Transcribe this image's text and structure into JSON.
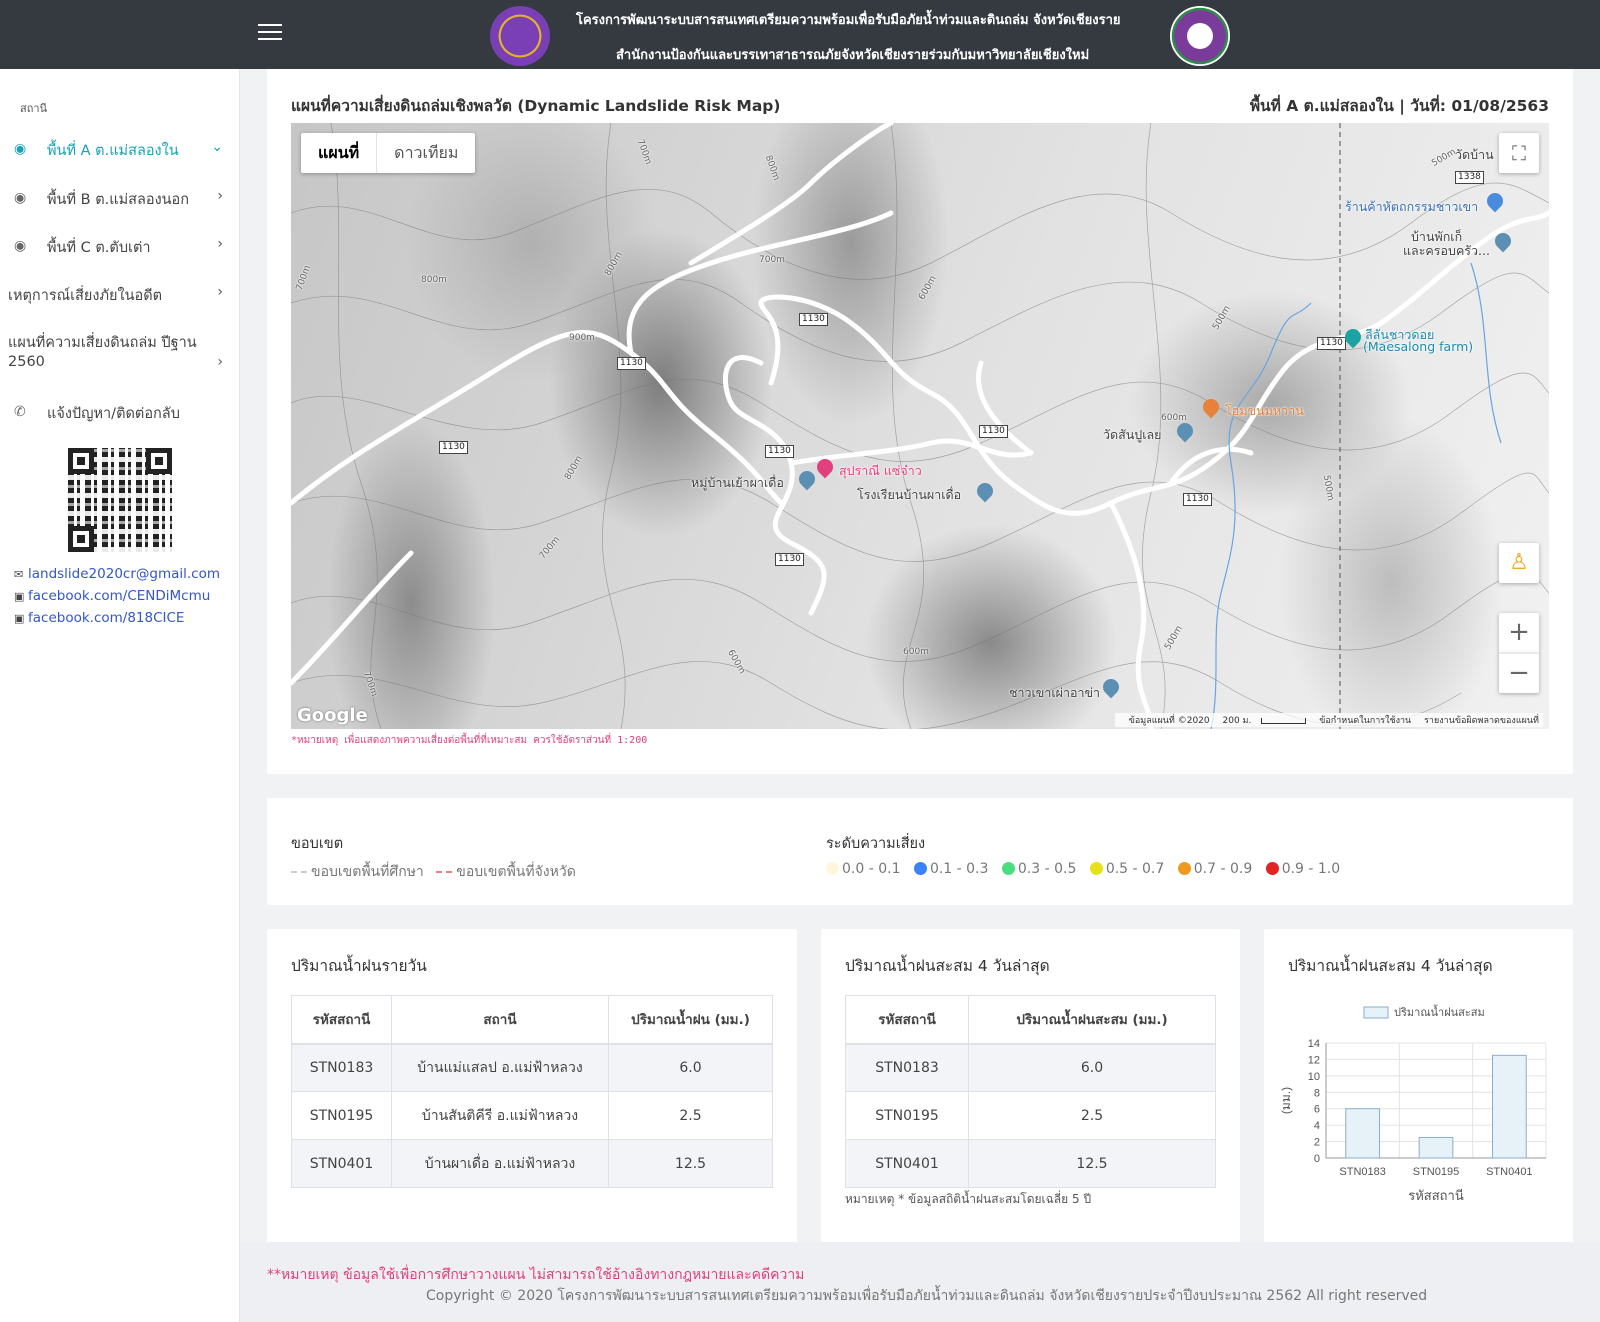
{
  "header": {
    "line1": "โครงการพัฒนาระบบสารสนเทศเตรียมความพร้อมเพื่อรับมือภัยน้ำท่วมและดินถล่ม จังหวัดเชียงราย",
    "line2": "สำนักงานป้องกันและบรรเทาสาธารณภัยจังหวัดเชียงรายร่วมกับมหาวิทยาลัยเชียงใหม่"
  },
  "sidebar": {
    "heading": "สถานี",
    "items": [
      {
        "label": "พื้นที่ A ต.แม่สลองใน",
        "icon": "map-pin-icon",
        "expanded": true
      },
      {
        "label": "พื้นที่ B ต.แม่สลองนอก",
        "icon": "map-pin-icon"
      },
      {
        "label": "พื้นที่ C ต.ตับเต่า",
        "icon": "map-pin-icon"
      },
      {
        "label": "เหตุการณ์เสี่ยงภัยในอดีต"
      },
      {
        "label_line1": "แผนที่ความเสี่ยงดินถล่ม ปีฐาน",
        "label_line2": "2560"
      },
      {
        "label": "แจ้งปัญหา/ติดต่อกลับ",
        "icon": "phone-icon"
      }
    ],
    "contacts": [
      {
        "text": "landslide2020cr@gmail.com",
        "icon": "envelope-icon"
      },
      {
        "text": "facebook.com/CENDiMcmu",
        "icon": "facebook-icon"
      },
      {
        "text": "facebook.com/818CICE",
        "icon": "facebook-icon"
      }
    ]
  },
  "map_card": {
    "title": "แผนที่ความเสี่ยงดินถล่มเชิงพลวัต (Dynamic Landslide Risk Map)",
    "area_date": "พื้นที่ A ต.แม่สลองใน | วันที่: 01/08/2563",
    "tabs": [
      "แผนที่",
      "ดาวเทียม"
    ],
    "active_tab": "แผนที่",
    "google": "Google",
    "footer": {
      "data": "ข้อมูลแผนที่ ©2020",
      "scale": "200 ม.",
      "terms": "ข้อกำหนดในการใช้งาน",
      "report": "รายงานข้อผิดพลาดของแผนที่"
    },
    "places": {
      "wat_ban": "วัดบ้าน",
      "shop": "ร้านค้าหัตถกรรมชาวเขา",
      "ban_line1": "บ้านพักเก็",
      "ban_line2": "และครอบครัว...",
      "farm_line1": "ลีลันชาวดอย",
      "farm_line2": "(Maesalong farm)",
      "hom": "โฮมขนมหวาน",
      "wat_san": "วัดสันปูเลย",
      "resort": "สุปราณี แซ่จ๋าว",
      "village": "หมู่บ้านเย้าผาเดื่อ",
      "school": "โรงเรียนบ้านผาเดื่อ",
      "akha": "ชาวเขาเผ่าอาข่า"
    },
    "roads": [
      "1130",
      "1130",
      "1130",
      "1130",
      "1130",
      "1130",
      "1130",
      "1130",
      "1338"
    ],
    "contours": [
      "700m",
      "800m",
      "800m",
      "900m",
      "700m",
      "800m",
      "700m",
      "600m",
      "600m",
      "500m",
      "600m",
      "500m",
      "500m",
      "700m",
      "600m",
      "700m",
      "800m",
      "500m"
    ],
    "note": "*หมายเหตุ เพื่อแสดงภาพความเสี่ยงต่อพื้นที่ที่เหมาะสม ควรใช้อัตราส่วนที่ 1:200"
  },
  "legend": {
    "boundary_title": "ขอบเขต",
    "boundaries": [
      {
        "label": "ขอบเขตพื้นที่ศึกษา",
        "color": "#cccccc"
      },
      {
        "label": "ขอบเขตพื้นที่จังหวัด",
        "color": "#f08080"
      }
    ],
    "risk_title": "ระดับความเสี่ยง",
    "risk_levels": [
      {
        "label": "0.0 - 0.1",
        "color": "#fff6dc"
      },
      {
        "label": "0.1 - 0.3",
        "color": "#3b82f6"
      },
      {
        "label": "0.3 - 0.5",
        "color": "#4ade80"
      },
      {
        "label": "0.5 - 0.7",
        "color": "#e5e21b"
      },
      {
        "label": "0.7 - 0.9",
        "color": "#ee9a1f"
      },
      {
        "label": "0.9 - 1.0",
        "color": "#e02424"
      }
    ]
  },
  "daily_rain": {
    "title": "ปริมาณน้ำฝนรายวัน",
    "headers": [
      "รหัสสถานี",
      "สถานี",
      "ปริมาณน้ำฝน (มม.)"
    ],
    "rows": [
      [
        "STN0183",
        "บ้านแม่แสลป อ.แม่ฟ้าหลวง",
        "6.0"
      ],
      [
        "STN0195",
        "บ้านสันติคีรี อ.แม่ฟ้าหลวง",
        "2.5"
      ],
      [
        "STN0401",
        "บ้านผาเดื่อ อ.แม่ฟ้าหลวง",
        "12.5"
      ]
    ]
  },
  "accum_rain": {
    "title": "ปริมาณน้ำฝนสะสม 4 วันล่าสุด",
    "headers": [
      "รหัสสถานี",
      "ปริมาณน้ำฝนสะสม (มม.)"
    ],
    "rows": [
      [
        "STN0183",
        "6.0"
      ],
      [
        "STN0195",
        "2.5"
      ],
      [
        "STN0401",
        "12.5"
      ]
    ],
    "note": "หมายเหตุ * ข้อมูลสถิติน้ำฝนสะสมโดยเฉลี่ย 5 ปี"
  },
  "chart_card": {
    "title": "ปริมาณน้ำฝนสะสม 4 วันล่าสุด"
  },
  "chart_data": {
    "type": "bar",
    "categories": [
      "STN0183",
      "STN0195",
      "STN0401"
    ],
    "series": [
      {
        "name": "ปริมาณน้ำฝนสะสม",
        "values": [
          6.0,
          2.5,
          12.5
        ]
      }
    ],
    "xlabel": "รหัสสถานี",
    "ylabel": "(มม.)",
    "ylim": [
      0,
      14
    ],
    "yticks": [
      0,
      2,
      4,
      6,
      8,
      10,
      12,
      14
    ],
    "legend": "top",
    "grid": true,
    "bar_color": "#e7f1f8",
    "bar_border": "#8aaecb"
  },
  "footer": {
    "note": "**หมายเหตุ ข้อมูลใช้เพื่อการศึกษาวางแผน ไม่สามารถใช้อ้างอิงทางกฎหมายและคดีความ",
    "copyright": "Copyright © 2020 โครงการพัฒนาระบบสารสนเทศเตรียมความพร้อมเพื่อรับมือภัยน้ำท่วมและดินถล่ม จังหวัดเชียงรายประจำปีงบประมาณ 2562 All right reserved"
  }
}
